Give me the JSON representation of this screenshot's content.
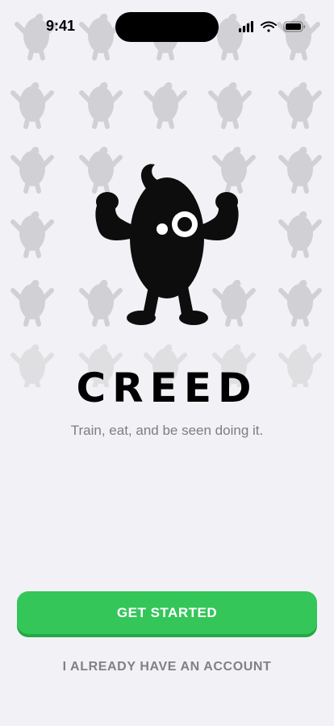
{
  "status_bar": {
    "time": "9:41"
  },
  "app": {
    "title": "CREED",
    "tagline": "Train, eat, and be seen doing it."
  },
  "actions": {
    "get_started": "GET STARTED",
    "have_account": "I ALREADY HAVE AN ACCOUNT"
  },
  "colors": {
    "background": "#f2f2f6",
    "accent": "#34c659",
    "mascot": "#0d0d0d"
  },
  "icons": [
    "cellular-signal-icon",
    "wifi-icon",
    "battery-icon",
    "creed-mascot-icon"
  ]
}
